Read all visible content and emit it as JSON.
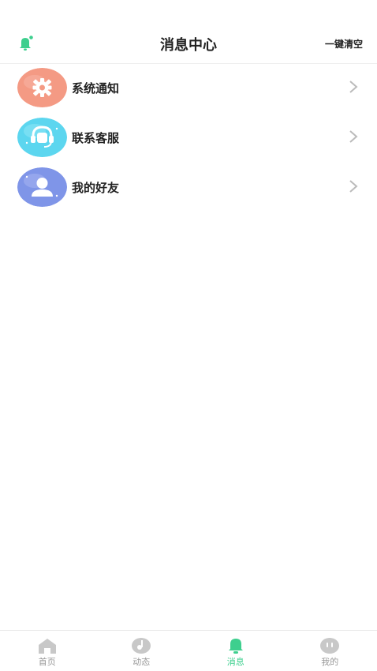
{
  "header": {
    "title": "消息中心",
    "clear_label": "一键清空",
    "bell_icon": "bell-icon",
    "accent": "#3ecf8e"
  },
  "list": {
    "items": [
      {
        "label": "系统通知",
        "icon": "gear-icon",
        "color": "#f49a84"
      },
      {
        "label": "联系客服",
        "icon": "headset-icon",
        "color": "#5cd6ef"
      },
      {
        "label": "我的好友",
        "icon": "user-icon",
        "color": "#7f95e8"
      }
    ]
  },
  "tabbar": {
    "tabs": [
      {
        "label": "首页",
        "icon": "home-icon",
        "active": false
      },
      {
        "label": "动态",
        "icon": "music-note-icon",
        "active": false
      },
      {
        "label": "消息",
        "icon": "bell-icon",
        "active": true
      },
      {
        "label": "我的",
        "icon": "face-icon",
        "active": false
      }
    ],
    "active_color": "#3ecf8e",
    "inactive_color": "#999999"
  }
}
